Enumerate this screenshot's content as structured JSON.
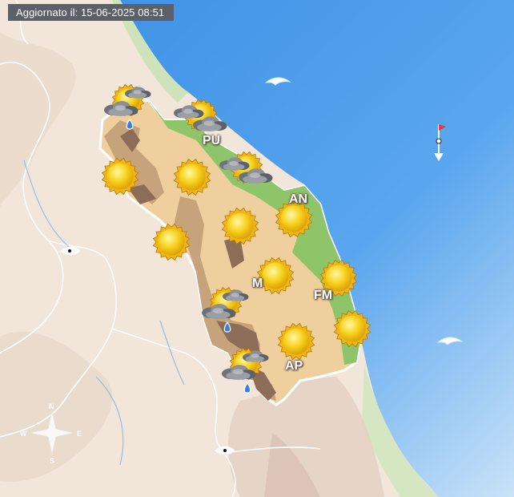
{
  "header": {
    "updated": "Aggiornato il: 15-06-2025 08:51"
  },
  "compass": {
    "north": "N",
    "south": "S",
    "east": "E",
    "west": "W"
  },
  "cities": [
    {
      "id": "pu",
      "label": "PU"
    },
    {
      "id": "an",
      "label": "AN"
    },
    {
      "id": "mc",
      "label": "M"
    },
    {
      "id": "fm",
      "label": "FM"
    },
    {
      "id": "ap",
      "label": "AP"
    }
  ],
  "forecast_icons": [
    {
      "id": "wx-urbino",
      "condition": "sun-cloud-rain"
    },
    {
      "id": "wx-pesaro",
      "condition": "sun-cloud"
    },
    {
      "id": "wx-cagli",
      "condition": "sunny"
    },
    {
      "id": "wx-fossombrone",
      "condition": "sunny"
    },
    {
      "id": "wx-senigallia",
      "condition": "sun-cloud"
    },
    {
      "id": "wx-ancona",
      "condition": "sunny"
    },
    {
      "id": "wx-fabriano",
      "condition": "sunny"
    },
    {
      "id": "wx-jesi",
      "condition": "sunny"
    },
    {
      "id": "wx-macerata",
      "condition": "sunny"
    },
    {
      "id": "wx-civitanova",
      "condition": "sunny"
    },
    {
      "id": "wx-camerino",
      "condition": "sun-cloud-rain"
    },
    {
      "id": "wx-sanbenedetto",
      "condition": "sunny"
    },
    {
      "id": "wx-ascoli",
      "condition": "sunny"
    },
    {
      "id": "wx-sibillini",
      "condition": "sun-cloud-rain"
    }
  ],
  "sea": {
    "conditions": [
      "calm-wave-icon",
      "calm-wave-icon"
    ],
    "wind": "north-wind-flag-icon"
  },
  "colors": {
    "sea": "#4a9be8",
    "coast_green": "#8fc56a",
    "hills": "#edd4a8",
    "mountains": "#c7a37c",
    "peaks": "#8e6d58",
    "outside": "#f1e6d9"
  }
}
